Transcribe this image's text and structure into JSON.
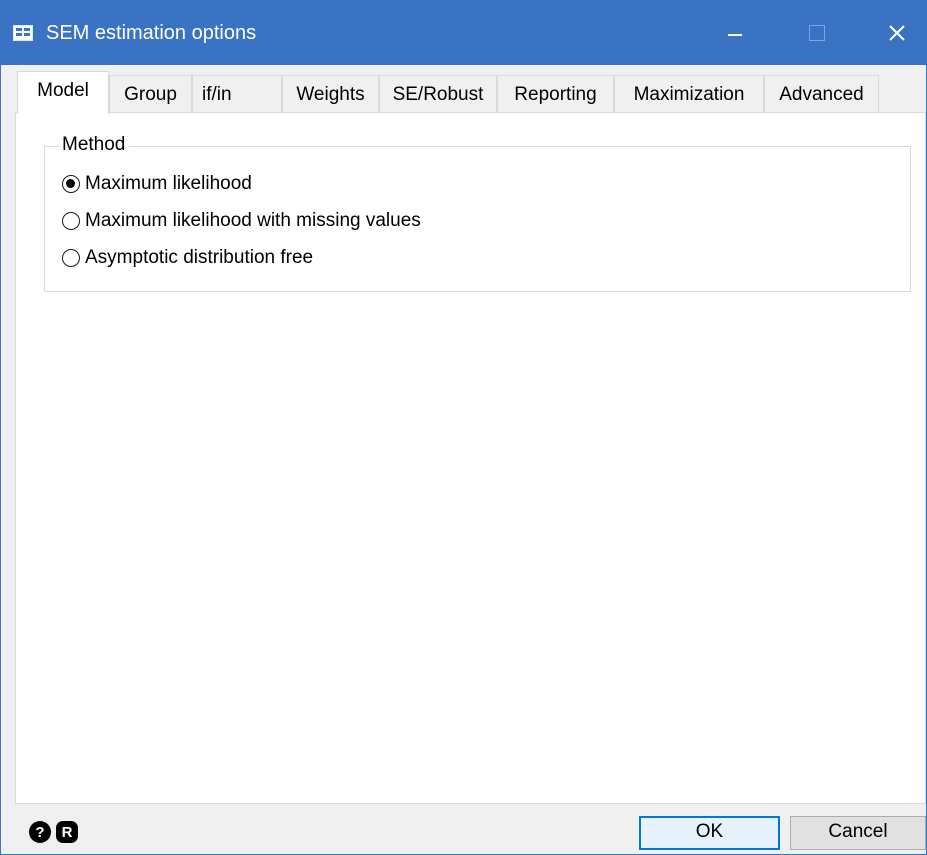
{
  "window": {
    "title": "SEM estimation options",
    "accent_color": "#3a72c4"
  },
  "titlebar_buttons": {
    "minimize_icon": "minimize-icon",
    "maximize_icon": "maximize-icon",
    "close_icon": "close-icon"
  },
  "tabs": [
    {
      "label": "Model",
      "active": true
    },
    {
      "label": "Group"
    },
    {
      "label": "if/in"
    },
    {
      "label": "Weights"
    },
    {
      "label": "SE/Robust"
    },
    {
      "label": "Reporting"
    },
    {
      "label": "Maximization"
    },
    {
      "label": "Advanced"
    }
  ],
  "method": {
    "label": "Method",
    "options": [
      {
        "label": "Maximum likelihood",
        "checked": true
      },
      {
        "label": "Maximum likelihood with missing values",
        "checked": false
      },
      {
        "label": "Asymptotic distribution free",
        "checked": false
      }
    ]
  },
  "footer": {
    "help_glyph": "?",
    "reset_glyph": "R",
    "ok_label": "OK",
    "cancel_label": "Cancel"
  }
}
